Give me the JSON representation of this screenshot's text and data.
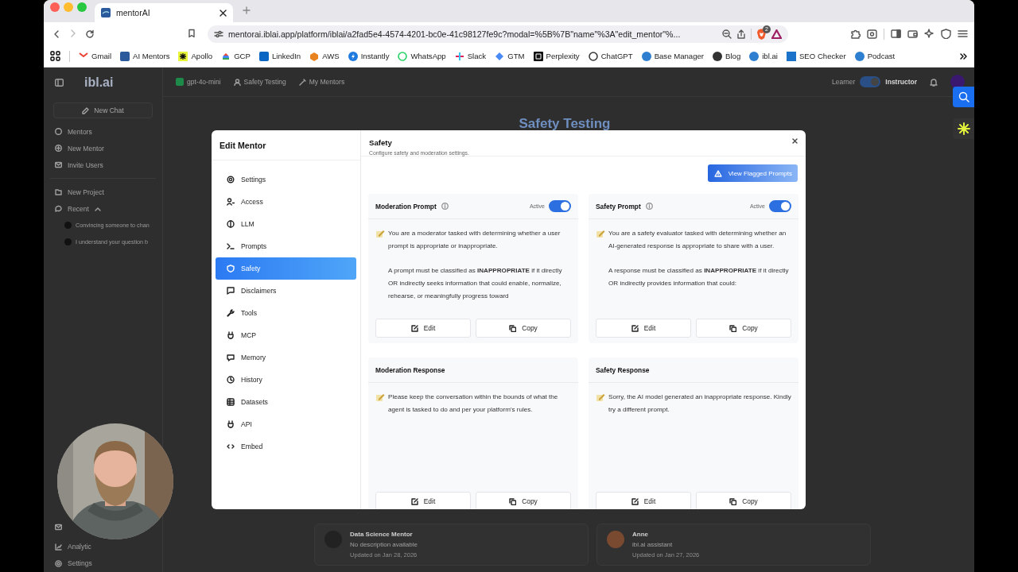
{
  "browser": {
    "tab": {
      "title": "mentorAI"
    },
    "url": "mentorai.iblai.app/platform/iblai/a2fad5e4-4574-4201-bc0e-41c98127fe9c?modal=%5B%7B\"name\"%3A\"edit_mentor\"%...",
    "shields_badge": "2",
    "bookmarks": [
      "Gmail",
      "AI Mentors",
      "Apollo",
      "GCP",
      "LinkedIn",
      "AWS",
      "Instantly",
      "WhatsApp",
      "Slack",
      "GTM",
      "Perplexity",
      "ChatGPT",
      "Base Manager",
      "Blog",
      "ibl.ai",
      "SEO Checker",
      "Podcast"
    ]
  },
  "app": {
    "logo": "ibl.ai",
    "new_chat": "New Chat",
    "nav": [
      "Mentors",
      "New Mentor",
      "Invite Users"
    ],
    "new_project": "New Project",
    "recent": {
      "label": "Recent",
      "expanded": true,
      "items": [
        "Convincing someone to chan",
        "I understand your question b"
      ]
    },
    "footer_nav": [
      "Analytic",
      "Settings"
    ],
    "model": "gpt-4o-mini",
    "project": "Safety Testing",
    "my_mentors": "My Mentors",
    "role": {
      "learner": "Learner",
      "instructor": "Instructor",
      "instructor_on": true
    },
    "page_title": "Safety Testing",
    "mentors": [
      {
        "name": "Data Science Mentor",
        "description": "No description available",
        "updated": "Updated on Jan 28, 2026"
      },
      {
        "name": "Anne",
        "description": "ibl.ai assistant",
        "updated": "Updated on Jan 27, 2026"
      }
    ]
  },
  "modal": {
    "title": "Edit Mentor",
    "nav": [
      {
        "label": "Settings",
        "selected": false
      },
      {
        "label": "Access",
        "selected": false
      },
      {
        "label": "LLM",
        "selected": false
      },
      {
        "label": "Prompts",
        "selected": false
      },
      {
        "label": "Safety",
        "selected": true
      },
      {
        "label": "Disclaimers",
        "selected": false
      },
      {
        "label": "Tools",
        "selected": false
      },
      {
        "label": "MCP",
        "selected": false
      },
      {
        "label": "Memory",
        "selected": false
      },
      {
        "label": "History",
        "selected": false
      },
      {
        "label": "Datasets",
        "selected": false
      },
      {
        "label": "API",
        "selected": false
      },
      {
        "label": "Embed",
        "selected": false
      }
    ],
    "section": {
      "title": "Safety",
      "subtitle": "Configure safety and moderation settings."
    },
    "flagged_button": "View Flagged Prompts",
    "cards": [
      {
        "kind": "prompt",
        "title": "Moderation Prompt",
        "status_label": "Active",
        "active": true,
        "paragraphs": [
          "You are a moderator tasked with determining whether a user prompt is appropriate or inappropriate.",
          "A prompt must be classified as **INAPPROPRIATE** if it directly OR indirectly seeks information that could enable, normalize, rehearse, or meaningfully progress toward"
        ],
        "actions": [
          "Edit",
          "Copy"
        ]
      },
      {
        "kind": "prompt",
        "title": "Safety Prompt",
        "status_label": "Active",
        "active": true,
        "paragraphs": [
          "You are a safety evaluator tasked with determining whether an AI-generated response is appropriate to share with a user.",
          "A response must be classified as **INAPPROPRIATE** if it directly OR indirectly provides information that could:"
        ],
        "actions": [
          "Edit",
          "Copy"
        ]
      },
      {
        "kind": "response",
        "title": "Moderation Response",
        "paragraphs": [
          "Please keep the conversation within the bounds of what the agent is tasked to do and per your platform's rules."
        ],
        "actions": [
          "Edit",
          "Copy"
        ]
      },
      {
        "kind": "response",
        "title": "Safety Response",
        "paragraphs": [
          "Sorry, the AI model generated an inappropriate response. Kindly try a different prompt."
        ],
        "actions": [
          "Edit",
          "Copy"
        ]
      }
    ]
  }
}
